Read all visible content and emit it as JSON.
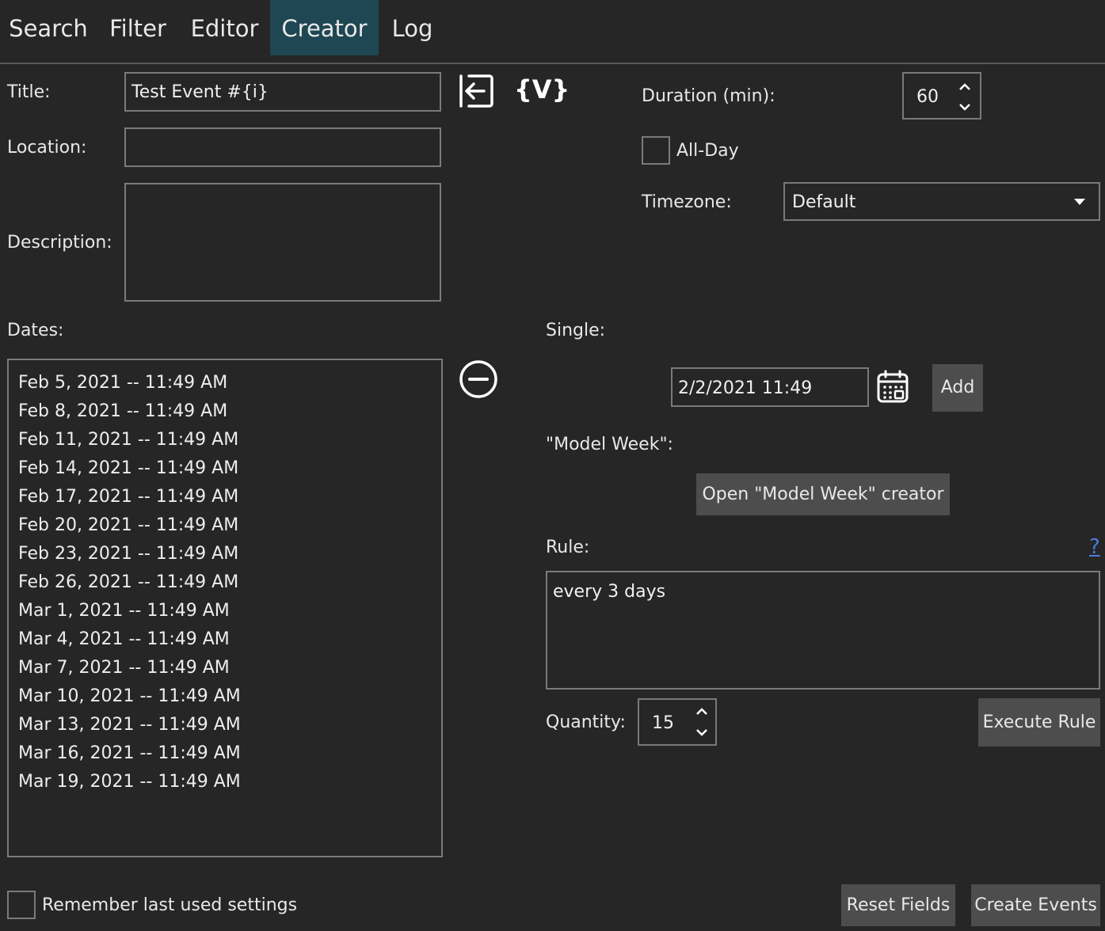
{
  "tabs": [
    "Search",
    "Filter",
    "Editor",
    "Creator",
    "Log"
  ],
  "active_tab": "Creator",
  "form": {
    "title_label": "Title:",
    "title_value": "Test Event #{i}",
    "location_label": "Location:",
    "location_value": "",
    "description_label": "Description:",
    "description_value": "",
    "variables_button": "{V}",
    "duration_label": "Duration (min):",
    "duration_value": "60",
    "allday_label": "All-Day",
    "timezone_label": "Timezone:",
    "timezone_value": "Default"
  },
  "dates": {
    "label": "Dates:",
    "items": [
      "Feb 5, 2021 -- 11:49 AM",
      "Feb 8, 2021 -- 11:49 AM",
      "Feb 11, 2021 -- 11:49 AM",
      "Feb 14, 2021 -- 11:49 AM",
      "Feb 17, 2021 -- 11:49 AM",
      "Feb 20, 2021 -- 11:49 AM",
      "Feb 23, 2021 -- 11:49 AM",
      "Feb 26, 2021 -- 11:49 AM",
      "Mar 1, 2021 -- 11:49 AM",
      "Mar 4, 2021 -- 11:49 AM",
      "Mar 7, 2021 -- 11:49 AM",
      "Mar 10, 2021 -- 11:49 AM",
      "Mar 13, 2021 -- 11:49 AM",
      "Mar 16, 2021 -- 11:49 AM",
      "Mar 19, 2021 -- 11:49 AM"
    ]
  },
  "single": {
    "label": "Single:",
    "date_value": "2/2/2021 11:49",
    "add_button": "Add"
  },
  "model_week": {
    "label": "\"Model Week\":",
    "open_button": "Open \"Model Week\" creator"
  },
  "rule": {
    "label": "Rule:",
    "help": "?",
    "value": "every 3 days",
    "quantity_label": "Quantity:",
    "quantity_value": "15",
    "execute_button": "Execute Rule"
  },
  "footer": {
    "remember_label": "Remember last used settings",
    "reset_button": "Reset Fields",
    "create_button": "Create Events"
  },
  "colors": {
    "background": "#262626",
    "active_tab": "#1f4653",
    "button": "#4d4d4d",
    "border": "#7a7a7a",
    "help_link": "#4a7bd9"
  },
  "icons": {
    "import": "arrow-into-box-icon",
    "remove": "minus-circle-icon",
    "calendar": "calendar-icon",
    "dropdown": "caret-down-icon",
    "spin_up": "chevron-up-icon",
    "spin_down": "chevron-down-icon"
  }
}
